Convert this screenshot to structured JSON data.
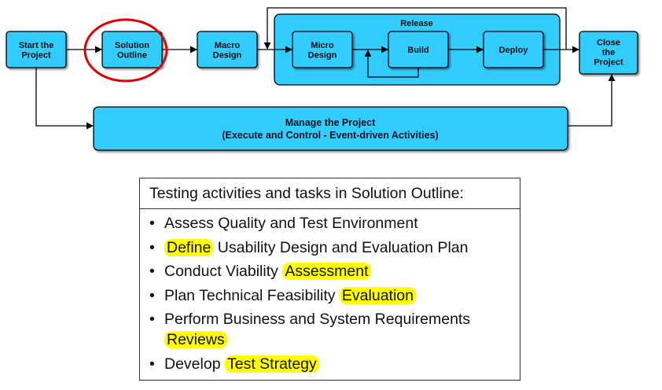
{
  "diagram": {
    "colors": {
      "box_fill": "#33ccff",
      "box_stroke": "#000000",
      "release_fill": "#33ccff",
      "highlight_circle": "#e00000",
      "text_highlight": "#ffff00"
    },
    "nodes": {
      "start": [
        "Start the",
        "Project"
      ],
      "solution_outline": [
        "Solution",
        "Outline"
      ],
      "macro_design": [
        "Macro",
        "Design"
      ],
      "micro_design": [
        "Micro",
        "Design"
      ],
      "build": [
        "Build"
      ],
      "deploy": [
        "Deploy"
      ],
      "close": [
        "Close",
        "the",
        "Project"
      ],
      "manage": [
        "Manage the Project",
        "(Execute and Control - Event-driven Activities)"
      ]
    },
    "release_label": "Release",
    "highlighted_node": "solution_outline"
  },
  "panel": {
    "title": "Testing activities and tasks in Solution Outline:",
    "bullet_glyph": "•",
    "items": [
      [
        {
          "text": "Assess Quality and Test Environment",
          "hl": false
        }
      ],
      [
        {
          "text": "Define",
          "hl": true
        },
        {
          "text": " Usability Design and Evaluation Plan",
          "hl": false
        }
      ],
      [
        {
          "text": "Conduct Viability ",
          "hl": false
        },
        {
          "text": "Assessment",
          "hl": true
        }
      ],
      [
        {
          "text": "Plan Technical Feasibility ",
          "hl": false
        },
        {
          "text": "Evaluation",
          "hl": true
        }
      ],
      [
        {
          "text": "Perform Business and System Requirements ",
          "hl": false
        },
        {
          "text": "Reviews",
          "hl": true
        }
      ],
      [
        {
          "text": "Develop ",
          "hl": false
        },
        {
          "text": "Test Strategy",
          "hl": true
        }
      ]
    ]
  }
}
